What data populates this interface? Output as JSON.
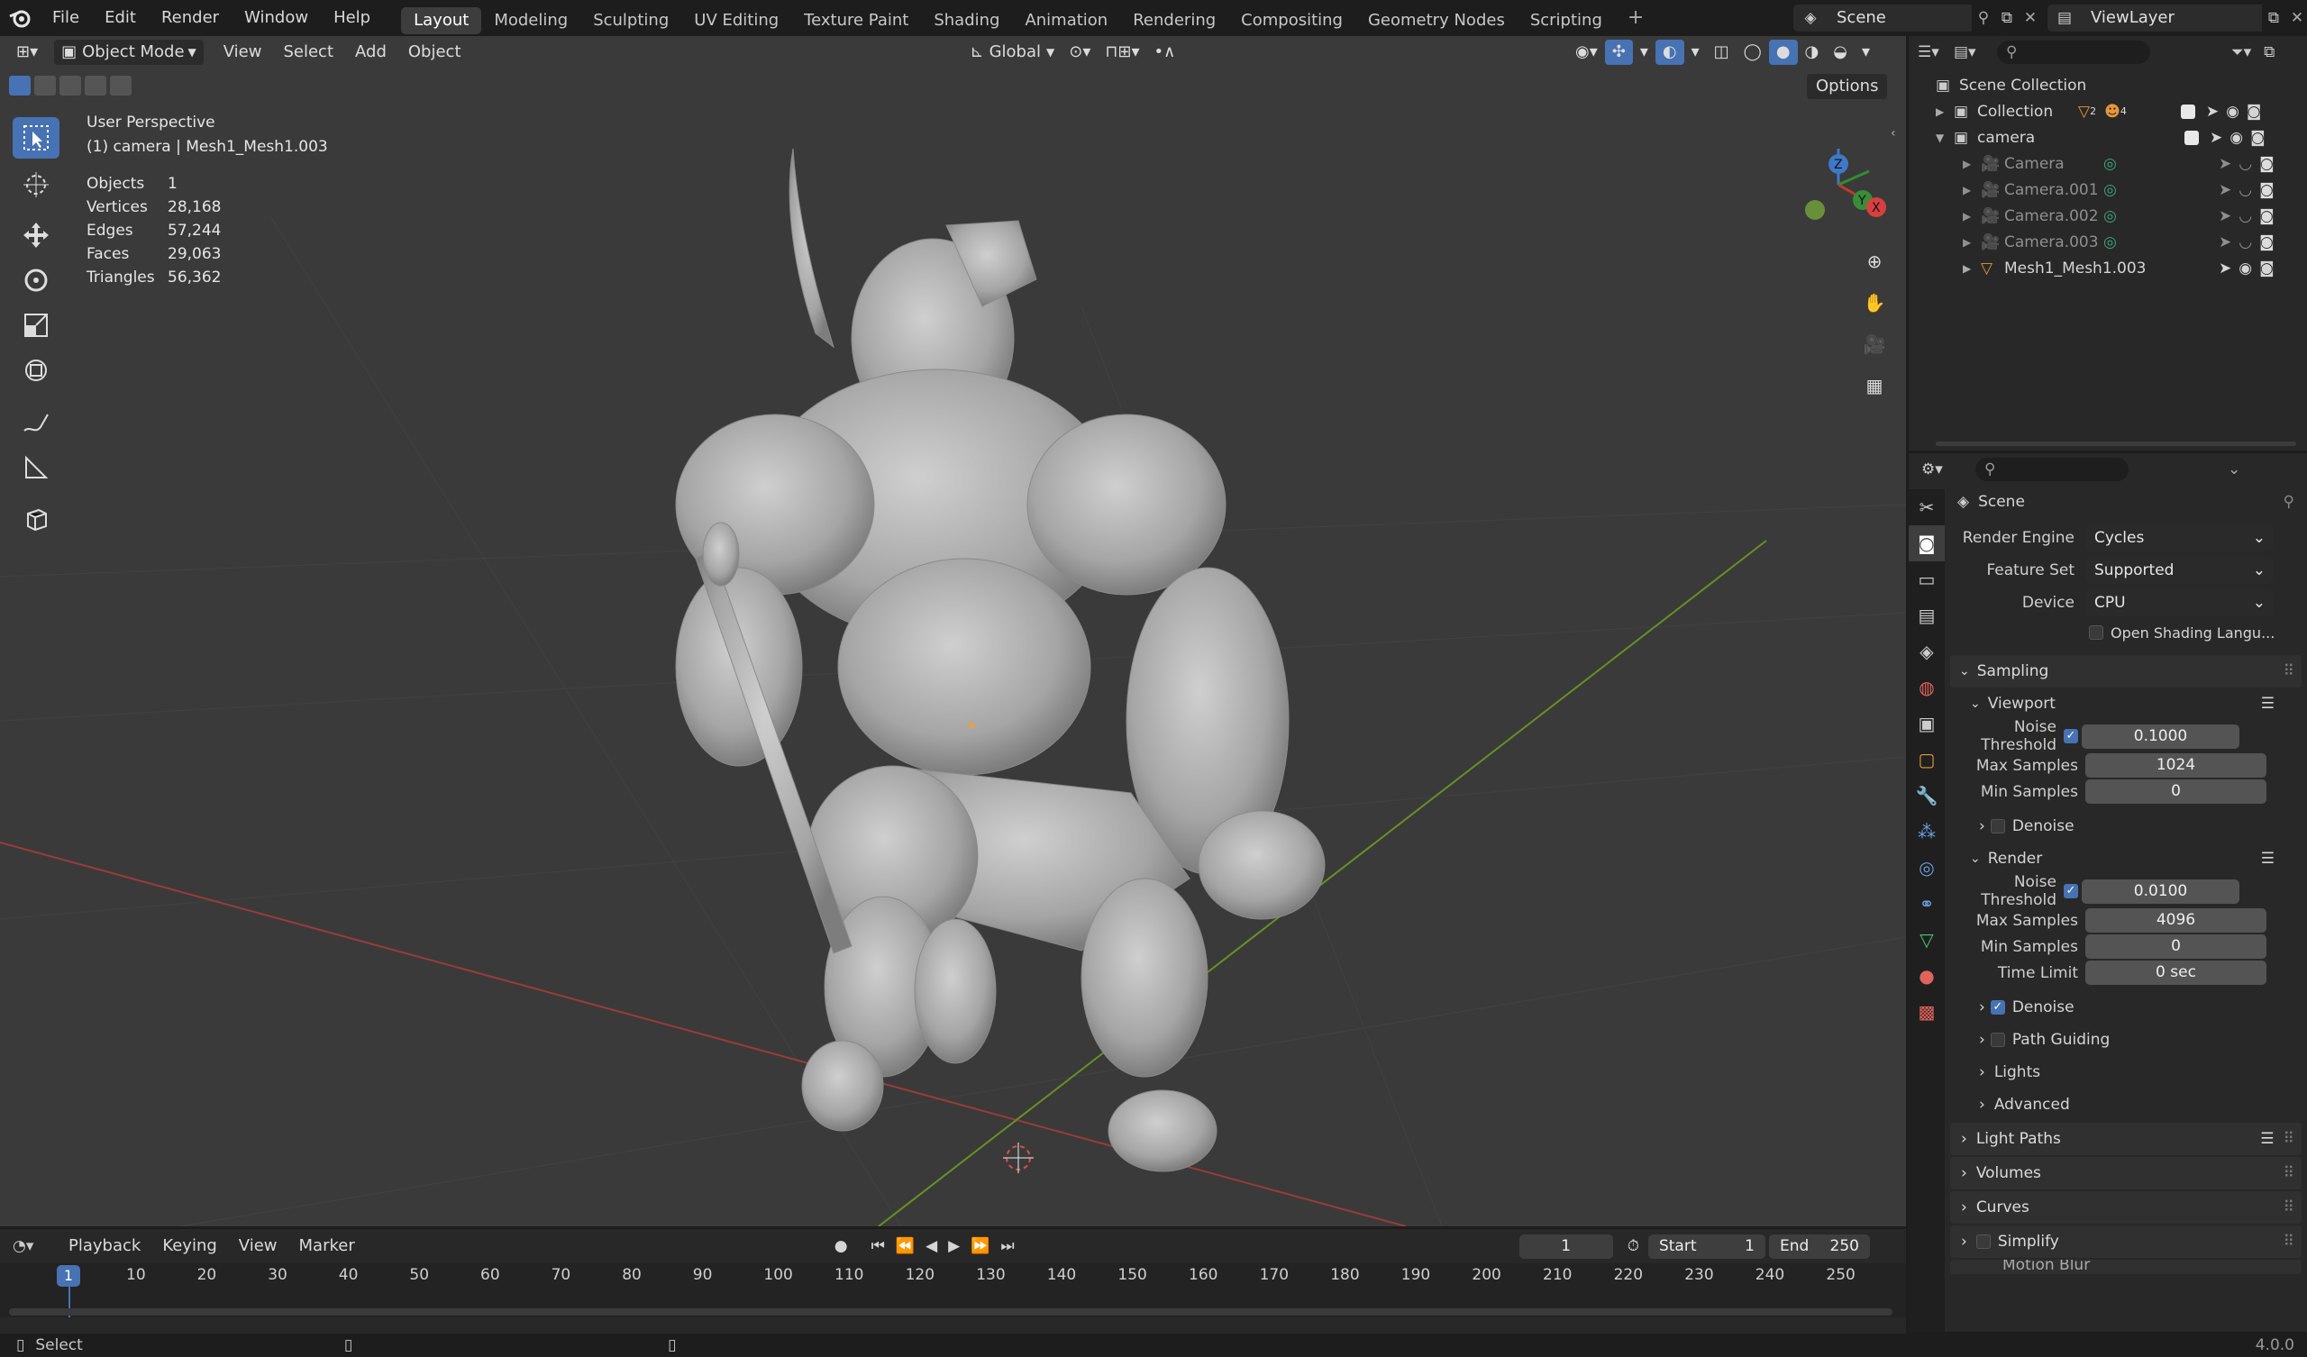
{
  "app": {
    "menu": [
      "File",
      "Edit",
      "Render",
      "Window",
      "Help"
    ],
    "workspaces": [
      "Layout",
      "Modeling",
      "Sculpting",
      "UV Editing",
      "Texture Paint",
      "Shading",
      "Animation",
      "Rendering",
      "Compositing",
      "Geometry Nodes",
      "Scripting"
    ],
    "active_workspace": "Layout",
    "add_workspace": "+",
    "scene": "Scene",
    "view_layer": "ViewLayer",
    "version": "4.0.0"
  },
  "viewport": {
    "mode": "Object Mode",
    "menus": [
      "View",
      "Select",
      "Add",
      "Object"
    ],
    "transform_orientation": "Global",
    "options_label": "Options",
    "overlay_title": "User Perspective",
    "overlay_subtitle": "(1) camera | Mesh1_Mesh1.003",
    "stats": [
      {
        "label": "Objects",
        "value": "1"
      },
      {
        "label": "Vertices",
        "value": "28,168"
      },
      {
        "label": "Edges",
        "value": "57,244"
      },
      {
        "label": "Faces",
        "value": "29,063"
      },
      {
        "label": "Triangles",
        "value": "56,362"
      }
    ],
    "gizmo": {
      "z": "Z",
      "y": "Y",
      "x": "X"
    }
  },
  "outliner": {
    "root": "Scene Collection",
    "items": [
      {
        "name": "Collection",
        "badge1": "2",
        "badge2": "4"
      },
      {
        "name": "camera"
      },
      {
        "name": "Camera"
      },
      {
        "name": "Camera.001"
      },
      {
        "name": "Camera.002"
      },
      {
        "name": "Camera.003"
      },
      {
        "name": "Mesh1_Mesh1.003"
      }
    ]
  },
  "properties": {
    "context": "Scene",
    "render_engine_label": "Render Engine",
    "render_engine": "Cycles",
    "feature_set_label": "Feature Set",
    "feature_set": "Supported",
    "device_label": "Device",
    "device": "CPU",
    "osl_label": "Open Shading Langu...",
    "sampling": "Sampling",
    "viewport_section": "Viewport",
    "render_section": "Render",
    "noise_threshold_label": "Noise Threshold",
    "max_samples_label": "Max Samples",
    "min_samples_label": "Min Samples",
    "time_limit_label": "Time Limit",
    "viewport_noise": "0.1000",
    "viewport_max": "1024",
    "viewport_min": "0",
    "render_noise": "0.0100",
    "render_max": "4096",
    "render_min": "0",
    "render_time_limit": "0 sec",
    "denoise": "Denoise",
    "path_guiding": "Path Guiding",
    "lights": "Lights",
    "advanced": "Advanced",
    "light_paths": "Light Paths",
    "volumes": "Volumes",
    "curves": "Curves",
    "simplify": "Simplify",
    "motion_blur": "Motion Blur"
  },
  "timeline": {
    "menus": [
      "Playback",
      "Keying",
      "View",
      "Marker"
    ],
    "current_frame": "1",
    "start_label": "Start",
    "start": "1",
    "end_label": "End",
    "end": "250",
    "ticks": [
      "10",
      "20",
      "30",
      "40",
      "50",
      "60",
      "70",
      "80",
      "90",
      "100",
      "110",
      "120",
      "130",
      "140",
      "150",
      "160",
      "170",
      "180",
      "190",
      "200",
      "210",
      "220",
      "230",
      "240",
      "250"
    ]
  },
  "status": {
    "select": "Select"
  }
}
